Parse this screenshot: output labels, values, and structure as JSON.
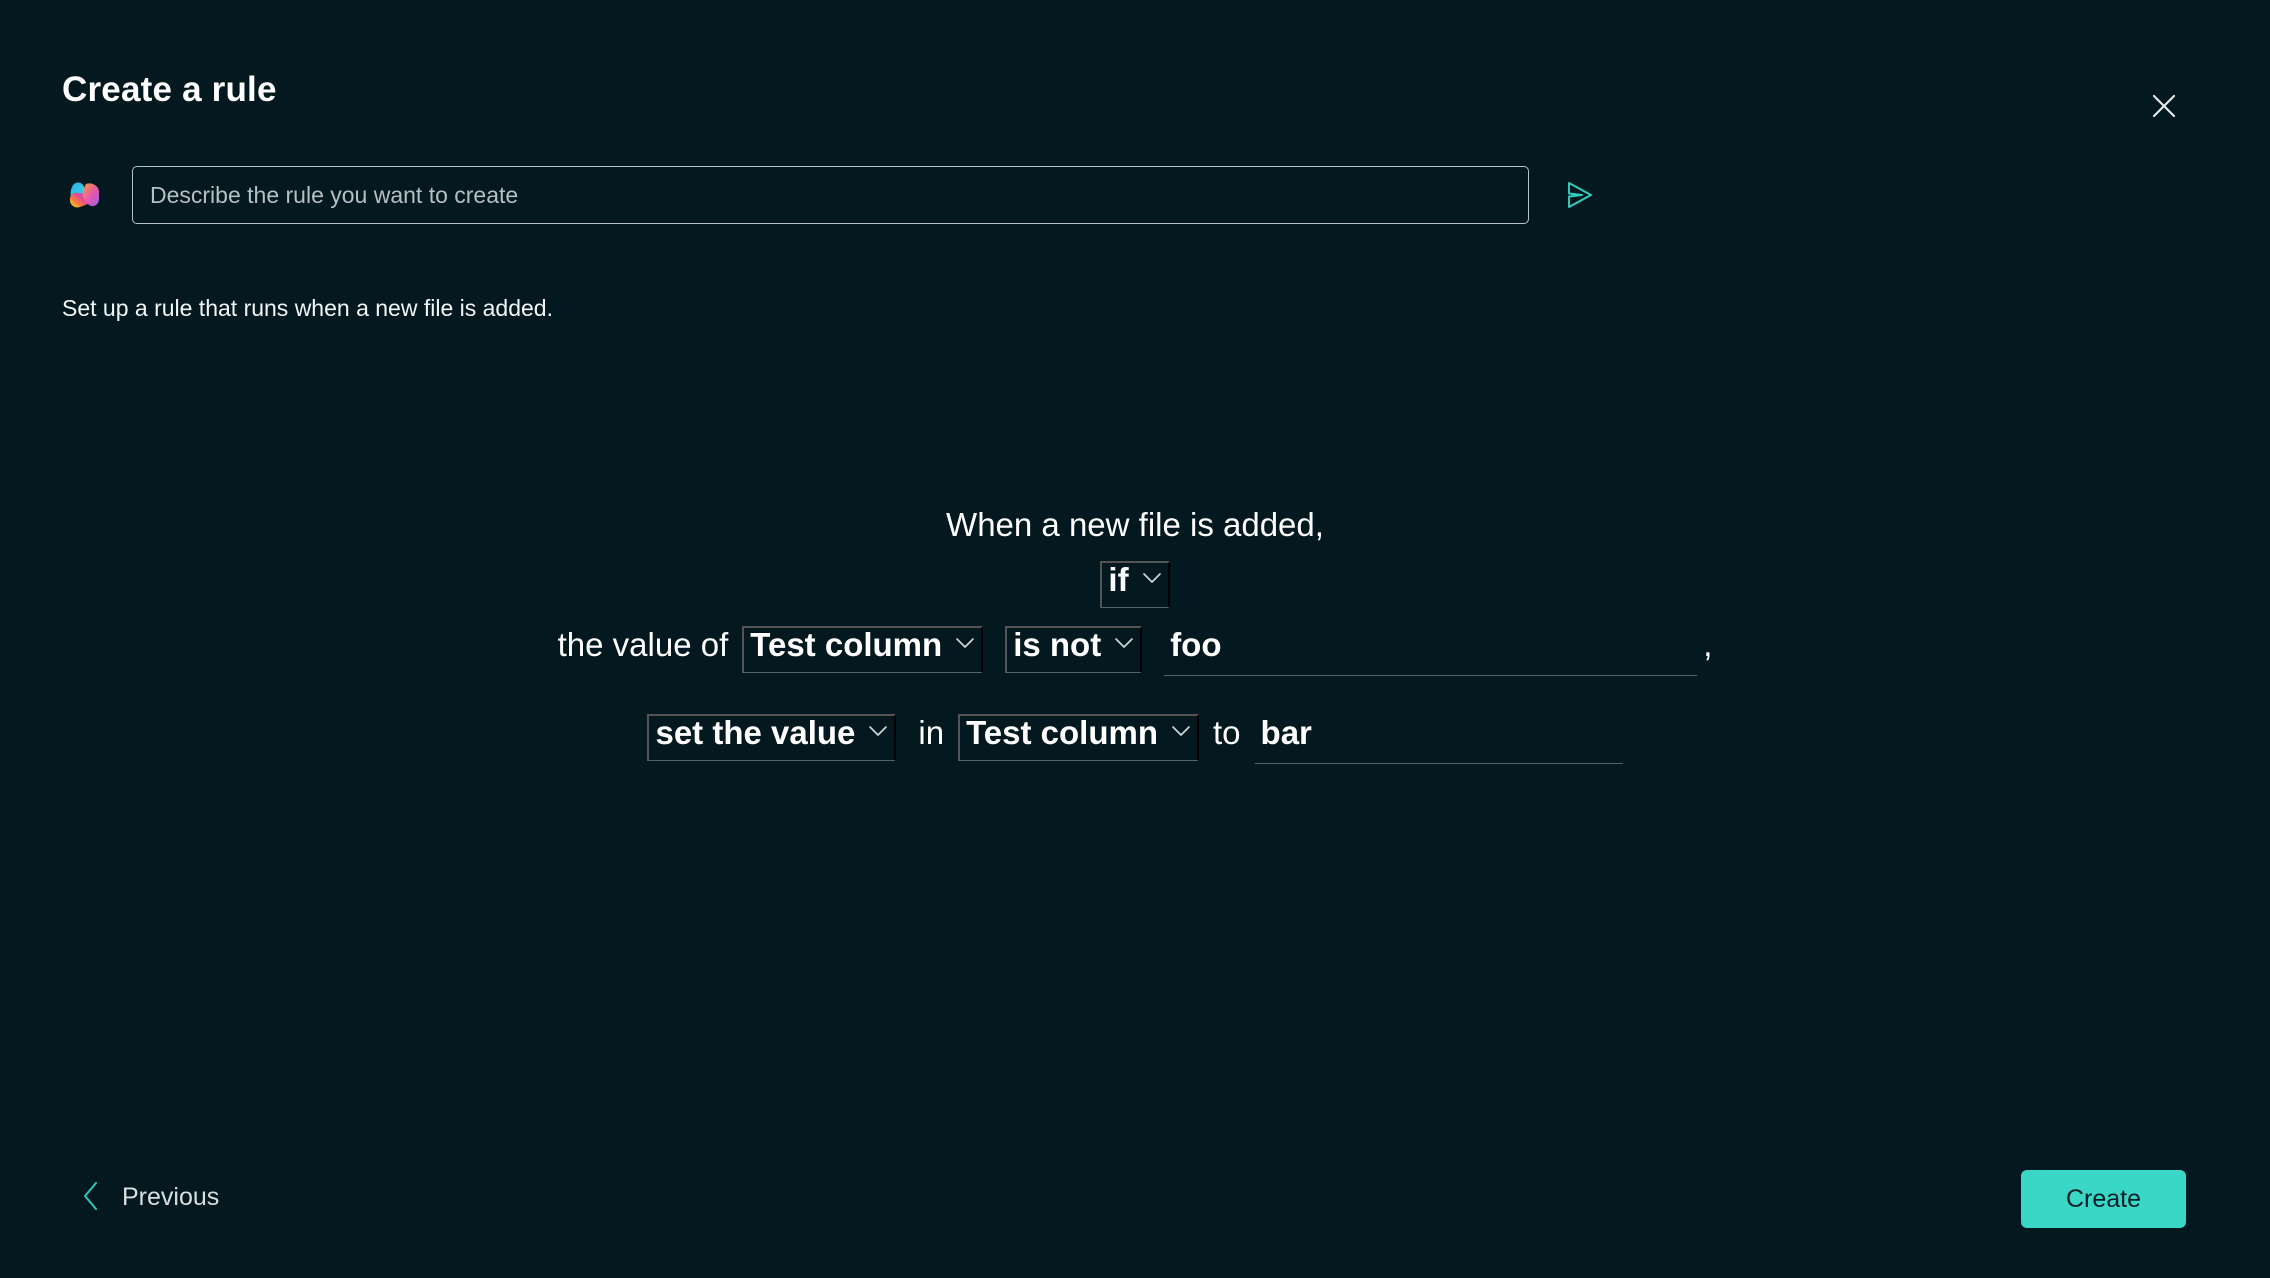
{
  "header": {
    "title": "Create a rule",
    "close_icon": "close-icon"
  },
  "prompt": {
    "copilot_icon": "copilot-icon",
    "placeholder": "Describe the rule you want to create",
    "value": "",
    "send_icon": "send-icon"
  },
  "subtitle": "Set up a rule that runs when a new file is added.",
  "rule": {
    "trigger_text": "When a new file is added,",
    "condition_keyword": {
      "label": "if",
      "chevron_icon": "chevron-down-icon"
    },
    "condition": {
      "prefix": "the value of",
      "column": {
        "label": "Test column",
        "chevron_icon": "chevron-down-icon"
      },
      "operator": {
        "label": "is not",
        "chevron_icon": "chevron-down-icon"
      },
      "value": "foo",
      "value_placeholder": "",
      "trailing_comma": ","
    },
    "action": {
      "verb": {
        "label": "set the value",
        "chevron_icon": "chevron-down-icon"
      },
      "in_text": "in",
      "column": {
        "label": "Test column",
        "chevron_icon": "chevron-down-icon"
      },
      "to_text": "to",
      "value": "bar",
      "value_placeholder": ""
    }
  },
  "footer": {
    "previous_label": "Previous",
    "previous_icon": "chevron-left-icon",
    "create_label": "Create"
  },
  "colors": {
    "background": "#03191f",
    "accent": "#3ad7c7",
    "text_primary": "#ffffff",
    "text_secondary": "#d9dfe0",
    "underline": "#51646a",
    "input_border": "#b9c2c4"
  }
}
